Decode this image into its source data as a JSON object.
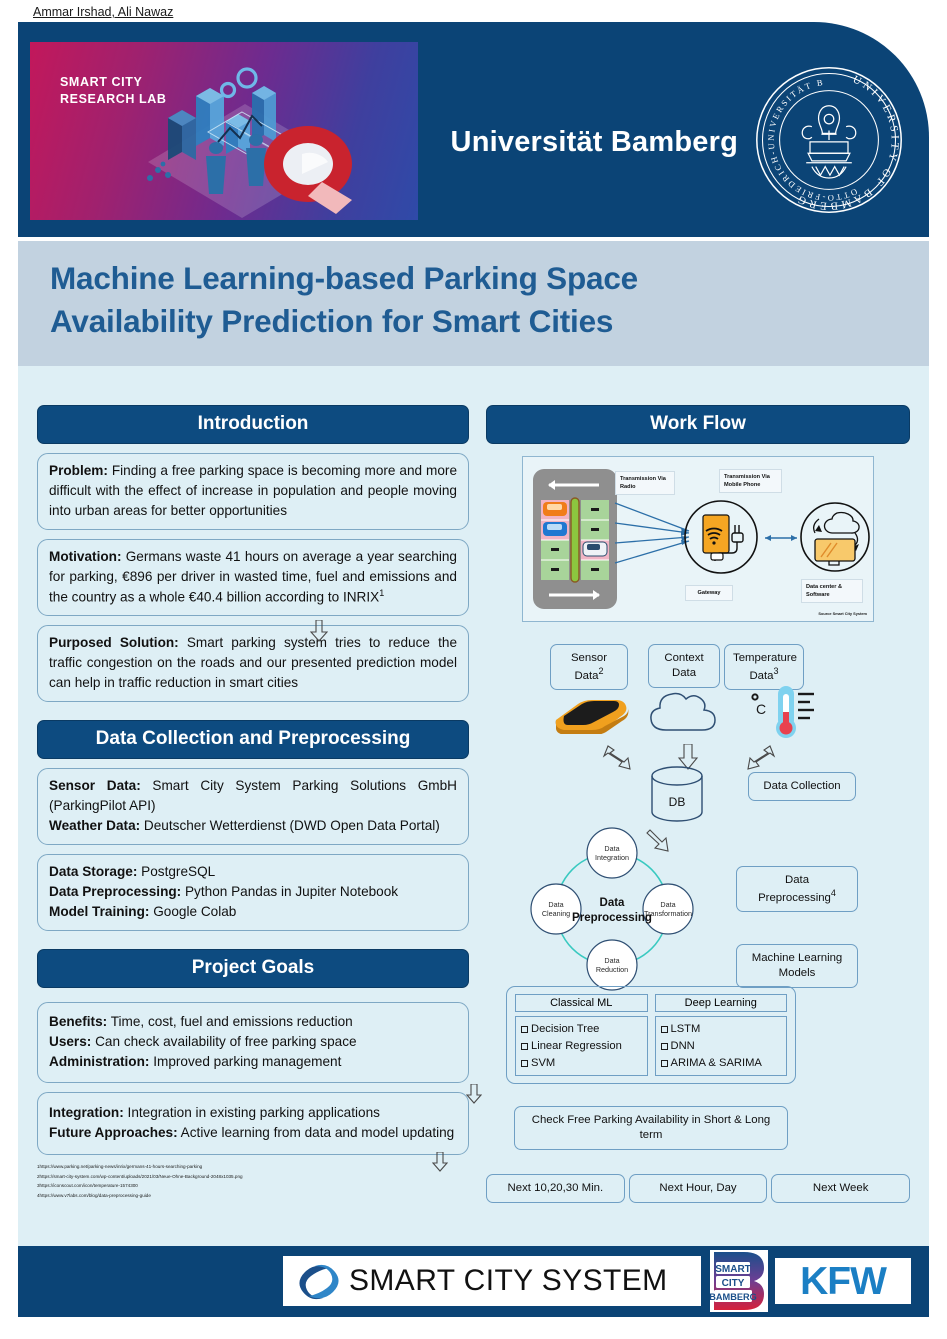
{
  "header": {
    "lab_name_line1": "SMART CITY",
    "lab_name_line2": "RESEARCH LAB",
    "university": "Universität Bamberg",
    "seal_outer_text": "UNIVERSITY OF BAMBERG",
    "seal_inner_text": "OTTO-FRIEDRICH-UNIVERSITÄT BAMBERG"
  },
  "title": {
    "line1": "Machine Learning-based Parking Space",
    "line2": "Availability Prediction for Smart Cities",
    "authors": "Ammar Irshad, Ali Nawaz"
  },
  "introduction": {
    "heading": "Introduction",
    "cards": [
      {
        "label": "Problem:",
        "text": " Finding a free parking space is becoming more and more difficult with the effect of increase in population and people moving into urban areas for better opportunities"
      },
      {
        "label": "Motivation:",
        "text": " Germans waste 41 hours on average a year searching for parking, €896 per driver in wasted time, fuel and emissions and the country as a whole €40.4 billion according to INRIX",
        "sup": "1"
      },
      {
        "label": "Purposed Solution:",
        "text": " Smart parking system tries to reduce the traffic congestion on the roads and our presented prediction model can help in traffic reduction in smart cities"
      }
    ]
  },
  "data_collection": {
    "heading": "Data Collection and Preprocessing",
    "card1": [
      {
        "label": "Sensor Data:",
        "text": " Smart City System Parking Solutions GmbH (ParkingPilot API)"
      },
      {
        "label": "Weather Data:",
        "text": " Deutscher Wetterdienst (DWD Open Data Portal)"
      }
    ],
    "card2": [
      {
        "label": "Data Storage:",
        "text": " PostgreSQL"
      },
      {
        "label": "Data Preprocessing:",
        "text": " Python Pandas in Jupiter Notebook"
      },
      {
        "label": "Model Training:",
        "text": " Google Colab"
      }
    ]
  },
  "project_goals": {
    "heading": "Project Goals",
    "card1": [
      {
        "label": "Benefits:",
        "text": "  Time, cost, fuel and emissions reduction"
      },
      {
        "label": "Users:",
        "text": " Can check availability of free parking space"
      },
      {
        "label": "Administration:",
        "text": " Improved parking management"
      }
    ],
    "card2": [
      {
        "label": "Integration:",
        "text": " Integration in existing parking applications"
      },
      {
        "label": "Future Approaches:",
        "text": " Active learning from data and model updating"
      }
    ]
  },
  "references": [
    "1https://www.parking.net/parking-news/inrix/germans-41-hours-searching-parking",
    "2https://smart-city-system.com/wp-content/uploads/2021/03/Neue-Ohne-Background-2048x1035.png",
    "3https://iconscout.com/icon/temperature-1574300",
    "4https://www.v7labs.com/blog/data-preprocessing-guide"
  ],
  "workflow": {
    "heading": "Work Flow",
    "diagram_labels": {
      "transmission_radio": "Transmission Via Radio",
      "transmission_mobile": "Transmission Via Mobile Phone",
      "gateway": "Gateway",
      "data_center": "Data center & Software",
      "source": "Source Smart City System"
    },
    "data_sources": [
      {
        "label": "Sensor Data",
        "sup": "2"
      },
      {
        "label": "Context Data",
        "sup": ""
      },
      {
        "label": "Temperature Data",
        "sup": "3"
      }
    ],
    "db_label": "DB",
    "stage_data_collection": "Data Collection",
    "stage_data_preprocessing": "Data Preprocessing",
    "stage_data_preprocessing_sup": "4",
    "stage_ml_models": "Machine Learning Models",
    "preprocessing_wheel": {
      "center_line1": "Data",
      "center_line2": "Preprocessing",
      "nodes": [
        {
          "line1": "Data",
          "line2": "Integration"
        },
        {
          "line1": "Data",
          "line2": "Transformation"
        },
        {
          "line1": "Data",
          "line2": "Reduction"
        },
        {
          "line1": "Data",
          "line2": "Cleaning"
        }
      ]
    },
    "models": {
      "classical_title": "Classical ML",
      "classical_items": [
        "Decision Tree",
        "Linear Regression",
        "SVM"
      ],
      "deep_title": "Deep Learning",
      "deep_items": [
        "LSTM",
        "DNN",
        "ARIMA & SARIMA"
      ]
    },
    "check_box": "Check Free Parking Availability in Short & Long term",
    "horizons": [
      "Next 10,20,30 Min.",
      "Next Hour, Day",
      "Next Week"
    ]
  },
  "footer": {
    "smart_city_system": "SMART CITY SYSTEM",
    "smart_city_bamberg_line1": "SMART",
    "smart_city_bamberg_line2": "CITY",
    "smart_city_bamberg_line3": "BAMBERG",
    "kfw": "KFW"
  },
  "colors": {
    "navy": "#0b4476",
    "title_blue": "#1f5c93",
    "band": "#c2d2e0",
    "body_bg": "#deeff5",
    "card_border": "#7ea8c4",
    "kfw_blue": "#1b7fc4"
  }
}
